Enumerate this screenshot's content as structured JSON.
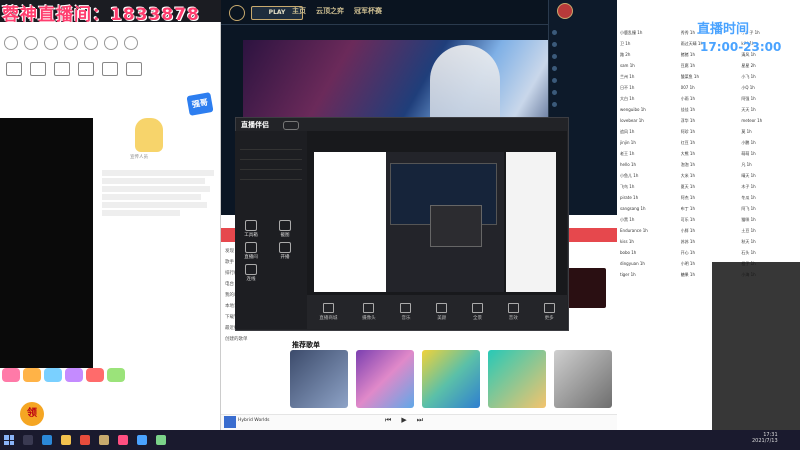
{
  "overlay": {
    "title": "蓉神直播间：1833878",
    "schedule": "直播时间",
    "hours": "17:00-23:00"
  },
  "left_app": {
    "greeting_badge": "强哥",
    "mascot_label": "宣传人员",
    "coin_label": "领"
  },
  "lol": {
    "play_label": "PLAY",
    "nav": [
      "主页",
      "云顶之弈",
      "冠军杯赛"
    ]
  },
  "stream_app": {
    "title": "直播伴侣",
    "tool_labels": [
      "工具箱",
      "截图",
      "直播间",
      "开播",
      "连线"
    ],
    "toolbar": [
      "直播商城",
      "摄像头",
      "音乐",
      "美颜",
      "全景",
      "音效",
      "更多"
    ]
  },
  "music": {
    "section_title": "推荐歌单",
    "nav_items": [
      "发现",
      "歌手",
      "排行榜",
      "电台",
      "我的收藏",
      "本地音乐",
      "下载管理",
      "最近播放",
      "创建的歌单"
    ],
    "now_playing": "Hybrid Worlds",
    "controls": [
      "⏮",
      "▶",
      "⏭"
    ]
  },
  "right_chat": {
    "entries": [
      "小鹿乱撞 1h",
      "秀秀 1h",
      "小盒子 1h",
      "卫 1h",
      "雨过天晴 1h",
      "kiki 1h",
      "路 2h",
      "猪猪 1h",
      "清风 1h",
      "sam 1h",
      "豆腐 1h",
      "星星 2h",
      "兰州 1h",
      "酸菜鱼 1h",
      "小飞 1h",
      "日不 1h",
      "007 1h",
      "小Q 1h",
      "大白 1h",
      "小雨 1h",
      "阿强 1h",
      "wenguibo 1h",
      "佳佳 1h",
      "天天 1h",
      "lovebear 1h",
      "浮华 1h",
      "meteor 1h",
      "追风 1h",
      "阿珍 1h",
      "莫 1h",
      "jinjin 1h",
      "红豆 1h",
      "小鹏 1h",
      "老王 1h",
      "大熊 1h",
      "萌萌 1h",
      "hello 1h",
      "泡泡 1h",
      "凡 1h",
      "小鱼儿 1h",
      "大米 1h",
      "晴天 1h",
      "飞鸟 1h",
      "夏天 1h",
      "木子 1h",
      "pirate 1h",
      "阿杰 1h",
      "冬瓜 1h",
      "sangsang 1h",
      "布丁 1h",
      "阿飞 1h",
      "小黑 1h",
      "可乐 1h",
      "猫咪 1h",
      "Endurance 1h",
      "小胖 1h",
      "土豆 1h",
      "kiss 1h",
      "苏苏 1h",
      "秋天 1h",
      "bobo 1h",
      "开心 1h",
      "石头 1h",
      "dingyuan 1h",
      "小明 1h",
      "橙子 1h",
      "tiger 1h",
      "糖果 1h",
      "小海 1h"
    ]
  },
  "taskbar": {
    "time": "17:31",
    "date": "2021/7/13"
  }
}
